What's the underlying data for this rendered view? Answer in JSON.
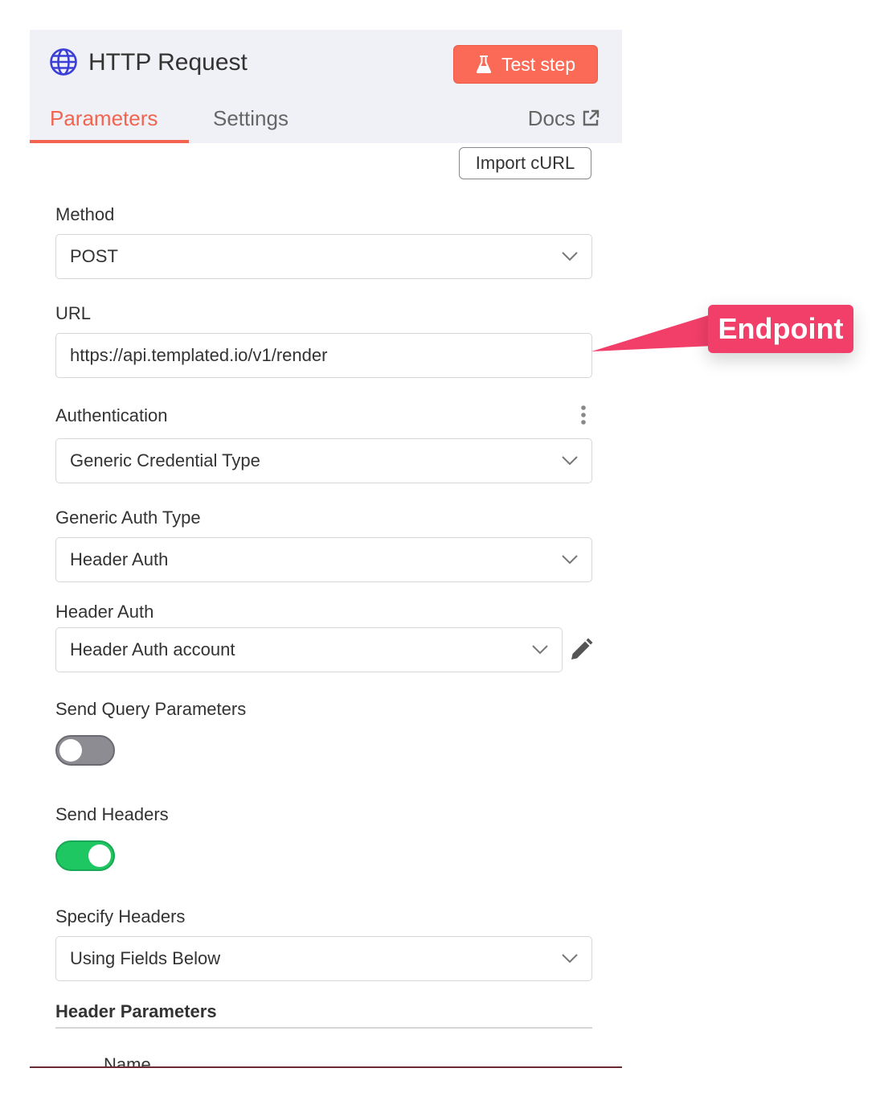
{
  "node": {
    "title": "HTTP Request",
    "test_button": "Test step"
  },
  "tabs": [
    {
      "label": "Parameters",
      "active": true
    },
    {
      "label": "Settings",
      "active": false
    }
  ],
  "docs_label": "Docs",
  "import_button": "Import cURL",
  "fields": {
    "method": {
      "label": "Method",
      "value": "POST"
    },
    "url": {
      "label": "URL",
      "value": "https://api.templated.io/v1/render"
    },
    "authentication": {
      "label": "Authentication",
      "value": "Generic Credential Type"
    },
    "generic_auth_type": {
      "label": "Generic Auth Type",
      "value": "Header Auth"
    },
    "header_auth": {
      "label": "Header Auth",
      "value": "Header Auth account"
    },
    "send_query": {
      "label": "Send Query Parameters",
      "enabled": false
    },
    "send_headers": {
      "label": "Send Headers",
      "enabled": true
    },
    "specify_headers": {
      "label": "Specify Headers",
      "value": "Using Fields Below"
    }
  },
  "header_parameters": {
    "title": "Header Parameters",
    "column_name": "Name"
  },
  "callout": {
    "label": "Endpoint"
  },
  "colors": {
    "accent": "#f26450",
    "test_button": "#fa6a57",
    "toggle_on": "#1ec761",
    "toggle_off": "#8c8c92",
    "callout": "#f23f6a",
    "globe_icon": "#3b3fd8"
  },
  "icons": [
    "globe-icon",
    "flask-icon",
    "external-link-icon",
    "chevron-down-icon",
    "more-vertical-icon",
    "pencil-icon"
  ]
}
